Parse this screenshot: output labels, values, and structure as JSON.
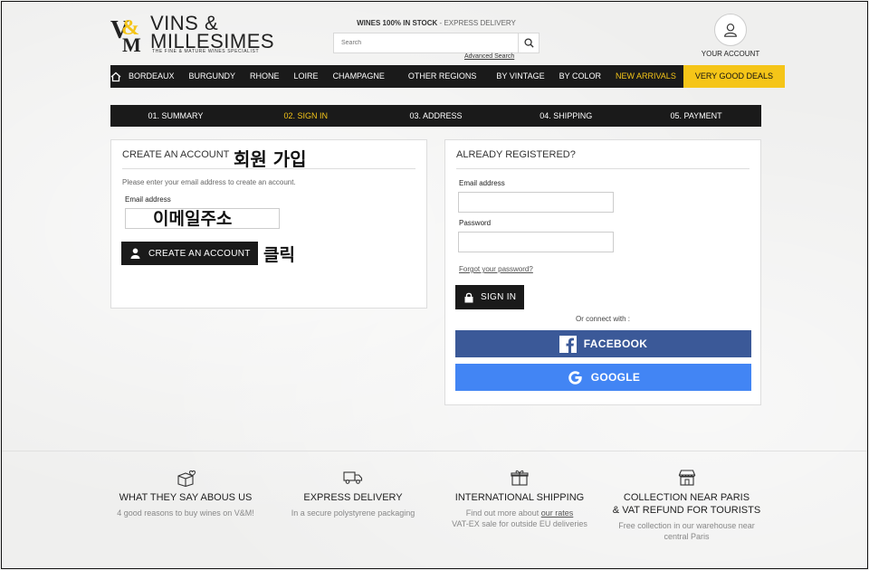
{
  "header": {
    "logo_mark": "V&M",
    "logo_line1": "VINS &",
    "logo_line2": "MILLESIMES",
    "logo_tagline": "THE FINE & MATURE WINES SPECIALIST",
    "stock_main": "WINES 100% IN STOCK",
    "stock_accent": " - EXPRESS DELIVERY",
    "search_placeholder": "Search",
    "advanced_search": "Advanced Search",
    "account_label": "YOUR ACCOUNT"
  },
  "nav": {
    "items": [
      "BORDEAUX",
      "BURGUNDY",
      "RHONE",
      "LOIRE",
      "CHAMPAGNE",
      "OTHER REGIONS",
      "BY VINTAGE",
      "BY COLOR"
    ],
    "new_arrivals": "NEW ARRIVALS",
    "deals": "VERY GOOD DEALS"
  },
  "steps": [
    "01. SUMMARY",
    "02. SIGN IN",
    "03. ADDRESS",
    "04. SHIPPING",
    "05. PAYMENT"
  ],
  "create_account": {
    "title": "CREATE AN ACCOUNT",
    "annotation_title": "회원 가입",
    "note": "Please enter your email address to create an account.",
    "email_label": "Email address",
    "email_annotation": "이메일주소",
    "button_label": "CREATE AN ACCOUNT",
    "button_annotation": "클릭"
  },
  "sign_in": {
    "title": "ALREADY REGISTERED?",
    "email_label": "Email address",
    "password_label": "Password",
    "forgot": "Forgot your password?",
    "button_label": "SIGN IN",
    "connect_with": "Or connect with :",
    "facebook": "FACEBOOK",
    "google": "GOOGLE"
  },
  "footer": {
    "features": [
      {
        "title": "WHAT THEY SAY ABOUS US",
        "desc1": "4 good reasons to buy wines on V&M!"
      },
      {
        "title": "EXPRESS DELIVERY",
        "desc1": "In a secure polystyrene packaging"
      },
      {
        "title": "INTERNATIONAL SHIPPING",
        "desc_pre": "Find out more about ",
        "desc_link": "our rates",
        "desc2": "VAT-EX sale for outside EU deliveries"
      },
      {
        "title": "COLLECTION NEAR PARIS",
        "title2": "& VAT REFUND FOR TOURISTS",
        "desc1": "Free collection in our warehouse near",
        "desc2": "central Paris"
      }
    ]
  },
  "colors": {
    "accent": "#f5c518",
    "dark": "#1a1a1a",
    "facebook": "#3b5998",
    "google": "#4285f4"
  }
}
